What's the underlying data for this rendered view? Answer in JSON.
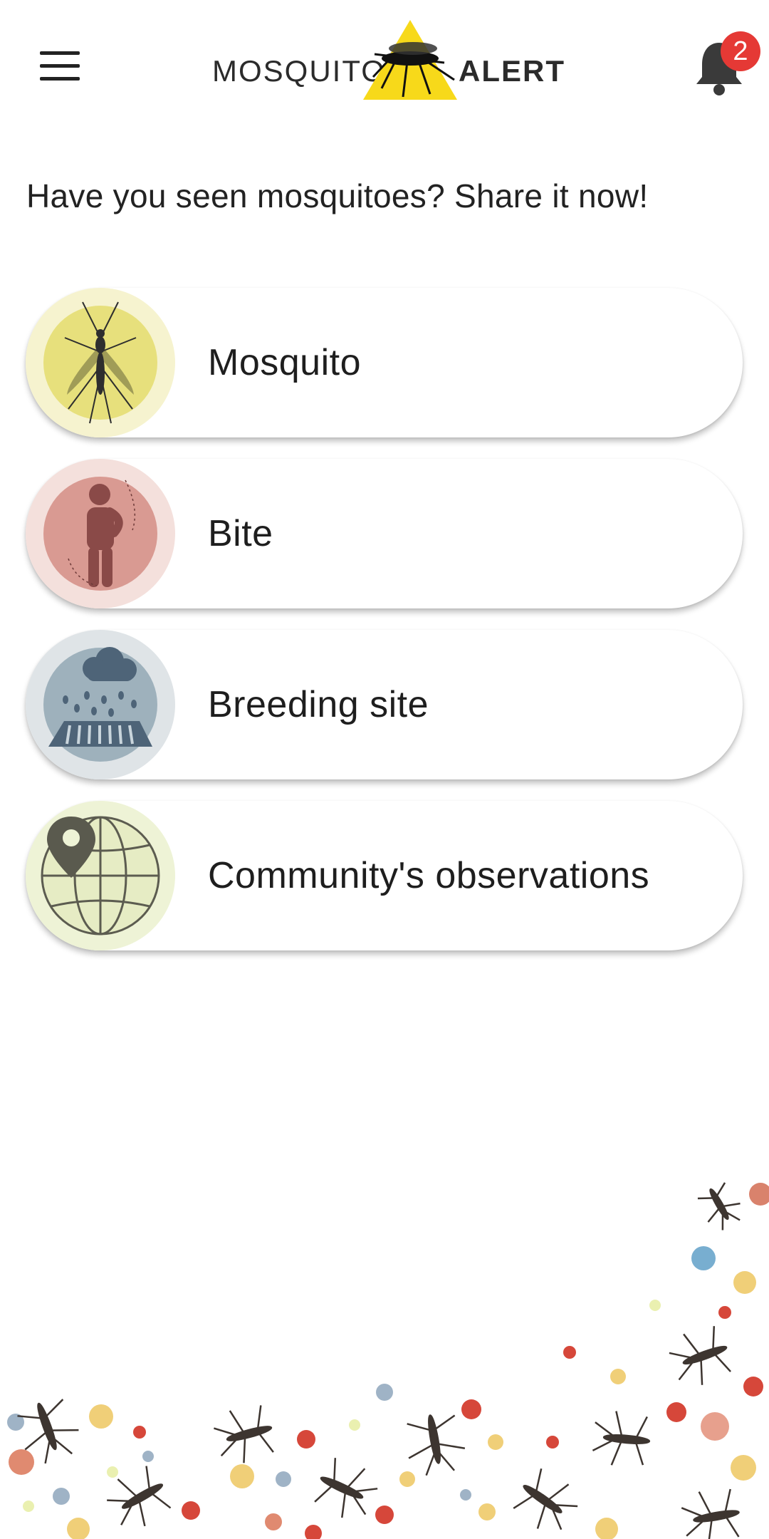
{
  "app": {
    "logo_left": "MOSQUITO",
    "logo_right": "ALERT",
    "notification_count": "2"
  },
  "headline": "Have you seen mosquitoes? Share it now!",
  "reports": [
    {
      "label": "Mosquito",
      "icon": "mosquito-icon"
    },
    {
      "label": "Bite",
      "icon": "bite-icon"
    },
    {
      "label": "Breeding site",
      "icon": "breeding-site-icon"
    },
    {
      "label": "Community's observations",
      "icon": "map-globe-icon"
    }
  ],
  "colors": {
    "mosquito_outer": "#f6f3cf",
    "mosquito_inner": "#e7e07c",
    "bite_outer": "#f4e0dc",
    "bite_inner": "#d99a92",
    "breeding_outer": "#dfe4e7",
    "breeding_inner": "#9eb1bc",
    "community_outer": "#eef3d6",
    "badge": "#e53935",
    "logo_triangle": "#f7d91a"
  }
}
